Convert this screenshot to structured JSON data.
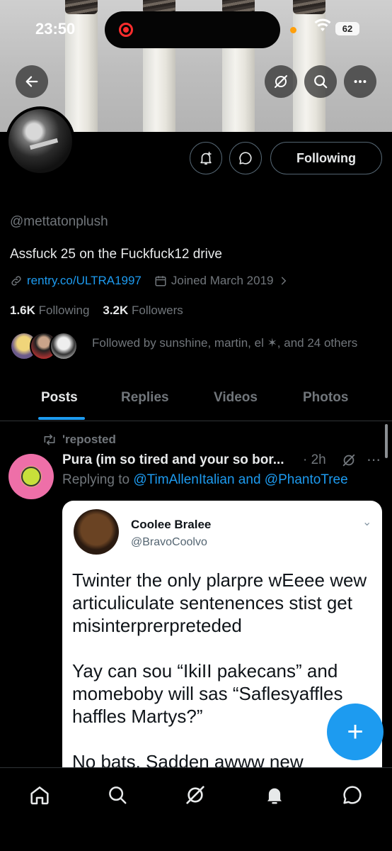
{
  "status_bar": {
    "time": "23:50",
    "battery": "62"
  },
  "profile": {
    "handle": "@mettatonplush",
    "bio": "Assfuck 25 on the Fuckfuck12 drive",
    "website": "rentry.co/ULTRA1997",
    "joined": "Joined March 2019",
    "following_count": "1.6K",
    "following_label": "Following",
    "followers_count": "3.2K",
    "followers_label": "Followers",
    "followed_by": "Followed by sunshine, martin, el ✶, and 24 others",
    "follow_button_label": "Following"
  },
  "tabs": [
    {
      "label": "Posts",
      "active": true
    },
    {
      "label": "Replies",
      "active": false
    },
    {
      "label": "Videos",
      "active": false
    },
    {
      "label": "Photos",
      "active": false
    }
  ],
  "post": {
    "repost_label": "'reposted",
    "author": "Pura (im so tired and your so bor...",
    "time": "· 2h",
    "replying_prefix": "Replying to ",
    "mention_1": "@TimAllenItalian",
    "and_text": " and ",
    "mention_2": "@PhantoTree",
    "embed": {
      "name": "Coolee Bralee",
      "handle": "@BravoCoolvo",
      "text": "Twinter the only plarpre wEeee wew articuliculate sentenences stist get misinterprerpreteded\n\nYay can sou “IkiII pakecans” and momeboby will sas “Saflesyaffles haffles Martys?”\n\nNo bats. Sadden awww new"
    }
  },
  "fab_label": "+",
  "colors": {
    "accent": "#1d9bf0",
    "background": "#000000",
    "secondary_text": "#71767b"
  }
}
